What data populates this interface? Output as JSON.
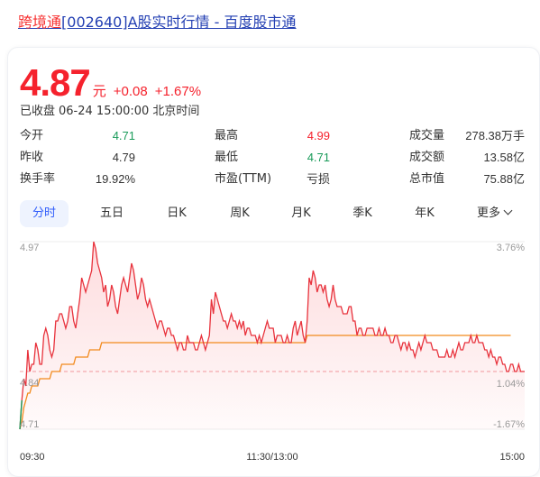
{
  "header": {
    "title_highlight": "跨境通",
    "title_rest": "[002640]A股实时行情 - 百度股市通"
  },
  "quote": {
    "price": "4.87",
    "unit": "元",
    "change": "+0.08",
    "change_pct": "+1.67%",
    "status": "已收盘",
    "datetime": "06-24 15:00:00",
    "timezone": "北京时间"
  },
  "stats": [
    {
      "label": "今开",
      "value": "4.71",
      "tone": "down"
    },
    {
      "label": "最高",
      "value": "4.99",
      "tone": "up"
    },
    {
      "label": "成交量",
      "value": "278.38万手",
      "tone": "neutral"
    },
    {
      "label": "昨收",
      "value": "4.79",
      "tone": "neutral"
    },
    {
      "label": "最低",
      "value": "4.71",
      "tone": "down"
    },
    {
      "label": "成交额",
      "value": "13.58亿",
      "tone": "neutral"
    },
    {
      "label": "换手率",
      "value": "19.92%",
      "tone": "neutral"
    },
    {
      "label": "市盈(TTM)",
      "value": "亏损",
      "tone": "neutral"
    },
    {
      "label": "总市值",
      "value": "75.88亿",
      "tone": "neutral"
    }
  ],
  "tabs": [
    {
      "label": "分时",
      "active": true
    },
    {
      "label": "五日",
      "active": false
    },
    {
      "label": "日K",
      "active": false
    },
    {
      "label": "周K",
      "active": false
    },
    {
      "label": "月K",
      "active": false
    },
    {
      "label": "季K",
      "active": false
    },
    {
      "label": "年K",
      "active": false
    },
    {
      "label": "更多",
      "active": false
    }
  ],
  "colors": {
    "up": "#f5222d",
    "down": "#1a9b5a",
    "price_line": "#e8323c",
    "avg_line": "#f28a1c",
    "accent": "#315efb"
  },
  "chart_data": {
    "type": "line",
    "y_left_ticks": [
      "4.97",
      "4.84",
      "4.71"
    ],
    "y_right_ticks": [
      "3.76%",
      "1.04%",
      "-1.67%"
    ],
    "x_ticks": [
      "09:30",
      "11:30/13:00",
      "15:00"
    ],
    "ylim": [
      4.71,
      4.97
    ],
    "prev_close": 4.79,
    "series": [
      {
        "name": "",
        "values": [
          4.71,
          4.75,
          4.78,
          4.77,
          4.82,
          4.79,
          4.8,
          4.8,
          4.83,
          4.82,
          4.8,
          4.8,
          4.84,
          4.85,
          4.84,
          4.82,
          4.81,
          4.82,
          4.86,
          4.86,
          4.87,
          4.87,
          4.86,
          4.85,
          4.86,
          4.88,
          4.88,
          4.86,
          4.85,
          4.87,
          4.89,
          4.92,
          4.91,
          4.9,
          4.91,
          4.92,
          4.93,
          4.97,
          4.96,
          4.94,
          4.93,
          4.92,
          4.9,
          4.91,
          4.88,
          4.89,
          4.91,
          4.9,
          4.88,
          4.87,
          4.89,
          4.91,
          4.92,
          4.91,
          4.9,
          4.92,
          4.94,
          4.93,
          4.91,
          4.89,
          4.9,
          4.92,
          4.91,
          4.89,
          4.88,
          4.89,
          4.88,
          4.87,
          4.86,
          4.85,
          4.86,
          4.86,
          4.85,
          4.84,
          4.85,
          4.85,
          4.84,
          4.84,
          4.83,
          4.82,
          4.83,
          4.83,
          4.82,
          4.82,
          4.84,
          4.83,
          4.83,
          4.83,
          4.82,
          4.82,
          4.83,
          4.84,
          4.83,
          4.82,
          4.83,
          4.84,
          4.89,
          4.87,
          4.9,
          4.89,
          4.88,
          4.87,
          4.86,
          4.86,
          4.85,
          4.86,
          4.87,
          4.86,
          4.86,
          4.85,
          4.86,
          4.85,
          4.86,
          4.84,
          4.85,
          4.85,
          4.84,
          4.84,
          4.84,
          4.83,
          4.84,
          4.83,
          4.84,
          4.85,
          4.86,
          4.85,
          4.85,
          4.85,
          4.83,
          4.84,
          4.84,
          4.84,
          4.83,
          4.83,
          4.84,
          4.83,
          4.83,
          4.85,
          4.86,
          4.84,
          4.85,
          4.86,
          4.84,
          4.83,
          4.86,
          4.92,
          4.91,
          4.93,
          4.92,
          4.9,
          4.91,
          4.91,
          4.9,
          4.91,
          4.89,
          4.88,
          4.89,
          4.91,
          4.89,
          4.88,
          4.88,
          4.88,
          4.87,
          4.87,
          4.87,
          4.88,
          4.88,
          4.86,
          4.86,
          4.84,
          4.85,
          4.85,
          4.84,
          4.84,
          4.85,
          4.85,
          4.85,
          4.85,
          4.84,
          4.84,
          4.85,
          4.84,
          4.84,
          4.85,
          4.84,
          4.84,
          4.83,
          4.83,
          4.84,
          4.84,
          4.83,
          4.82,
          4.83,
          4.83,
          4.82,
          4.83,
          4.82,
          4.82,
          4.81,
          4.82,
          4.83,
          4.82,
          4.83,
          4.84,
          4.83,
          4.83,
          4.83,
          4.82,
          4.82,
          4.82,
          4.81,
          4.81,
          4.81,
          4.81,
          4.82,
          4.81,
          4.81,
          4.82,
          4.81,
          4.82,
          4.83,
          4.82,
          4.82,
          4.83,
          4.83,
          4.83,
          4.84,
          4.83,
          4.83,
          4.84,
          4.83,
          4.83,
          4.83,
          4.82,
          4.82,
          4.81,
          4.82,
          4.81,
          4.81,
          4.8,
          4.81,
          4.81,
          4.8,
          4.8,
          4.79,
          4.79,
          4.8,
          4.8,
          4.79,
          4.79,
          4.8,
          4.79,
          4.79,
          4.79
        ]
      },
      {
        "name": "",
        "values": [
          4.71,
          4.72,
          4.74,
          4.75,
          4.76,
          4.76,
          4.77,
          4.77,
          4.77,
          4.77,
          4.78,
          4.78,
          4.78,
          4.78,
          4.78,
          4.78,
          4.79,
          4.79,
          4.79,
          4.79,
          4.79,
          4.8,
          4.8,
          4.8,
          4.8,
          4.8,
          4.8,
          4.8,
          4.81,
          4.81,
          4.81,
          4.81,
          4.81,
          4.81,
          4.81,
          4.82,
          4.82,
          4.82,
          4.82,
          4.82,
          4.82,
          4.83,
          4.83,
          4.83,
          4.83,
          4.83,
          4.83,
          4.83,
          4.83,
          4.83,
          4.83,
          4.83,
          4.83,
          4.83,
          4.83,
          4.83,
          4.83,
          4.83,
          4.83,
          4.83,
          4.83,
          4.83,
          4.83,
          4.83,
          4.83,
          4.83,
          4.83,
          4.83,
          4.83,
          4.83,
          4.83,
          4.83,
          4.83,
          4.83,
          4.83,
          4.83,
          4.83,
          4.83,
          4.83,
          4.83,
          4.83,
          4.83,
          4.83,
          4.83,
          4.83,
          4.83,
          4.83,
          4.83,
          4.83,
          4.83,
          4.83,
          4.83,
          4.83,
          4.83,
          4.83,
          4.83,
          4.83,
          4.83,
          4.83,
          4.83,
          4.83,
          4.83,
          4.83,
          4.83,
          4.83,
          4.83,
          4.83,
          4.83,
          4.83,
          4.83,
          4.83,
          4.83,
          4.83,
          4.83,
          4.83,
          4.83,
          4.83,
          4.83,
          4.83,
          4.83,
          4.83,
          4.83,
          4.83,
          4.83,
          4.83,
          4.83,
          4.83,
          4.83,
          4.83,
          4.83,
          4.83,
          4.83,
          4.83,
          4.83,
          4.83,
          4.83,
          4.83,
          4.83,
          4.83,
          4.83,
          4.83,
          4.83,
          4.83,
          4.83,
          4.84,
          4.84,
          4.84,
          4.84,
          4.84,
          4.84,
          4.84,
          4.84,
          4.84,
          4.84,
          4.84,
          4.84,
          4.84,
          4.84,
          4.84,
          4.84,
          4.84,
          4.84,
          4.84,
          4.84,
          4.84,
          4.84,
          4.84,
          4.84,
          4.84,
          4.84,
          4.84,
          4.84,
          4.84,
          4.84,
          4.84,
          4.84,
          4.84,
          4.84,
          4.84,
          4.84,
          4.84,
          4.84,
          4.84,
          4.84,
          4.84,
          4.84,
          4.84,
          4.84,
          4.84,
          4.84,
          4.84,
          4.84,
          4.84,
          4.84,
          4.84,
          4.84,
          4.84,
          4.84,
          4.84,
          4.84,
          4.84,
          4.84,
          4.84,
          4.84,
          4.84,
          4.84,
          4.84,
          4.84,
          4.84,
          4.84,
          4.84,
          4.84,
          4.84,
          4.84,
          4.84,
          4.84,
          4.84,
          4.84,
          4.84,
          4.84,
          4.84,
          4.84,
          4.84,
          4.84,
          4.84,
          4.84,
          4.84,
          4.84,
          4.84,
          4.84,
          4.84,
          4.84,
          4.84,
          4.84,
          4.84,
          4.84,
          4.84,
          4.84,
          4.84,
          4.84,
          4.84,
          4.84,
          4.84,
          4.84,
          4.84,
          4.84,
          4.84
        ]
      }
    ]
  }
}
